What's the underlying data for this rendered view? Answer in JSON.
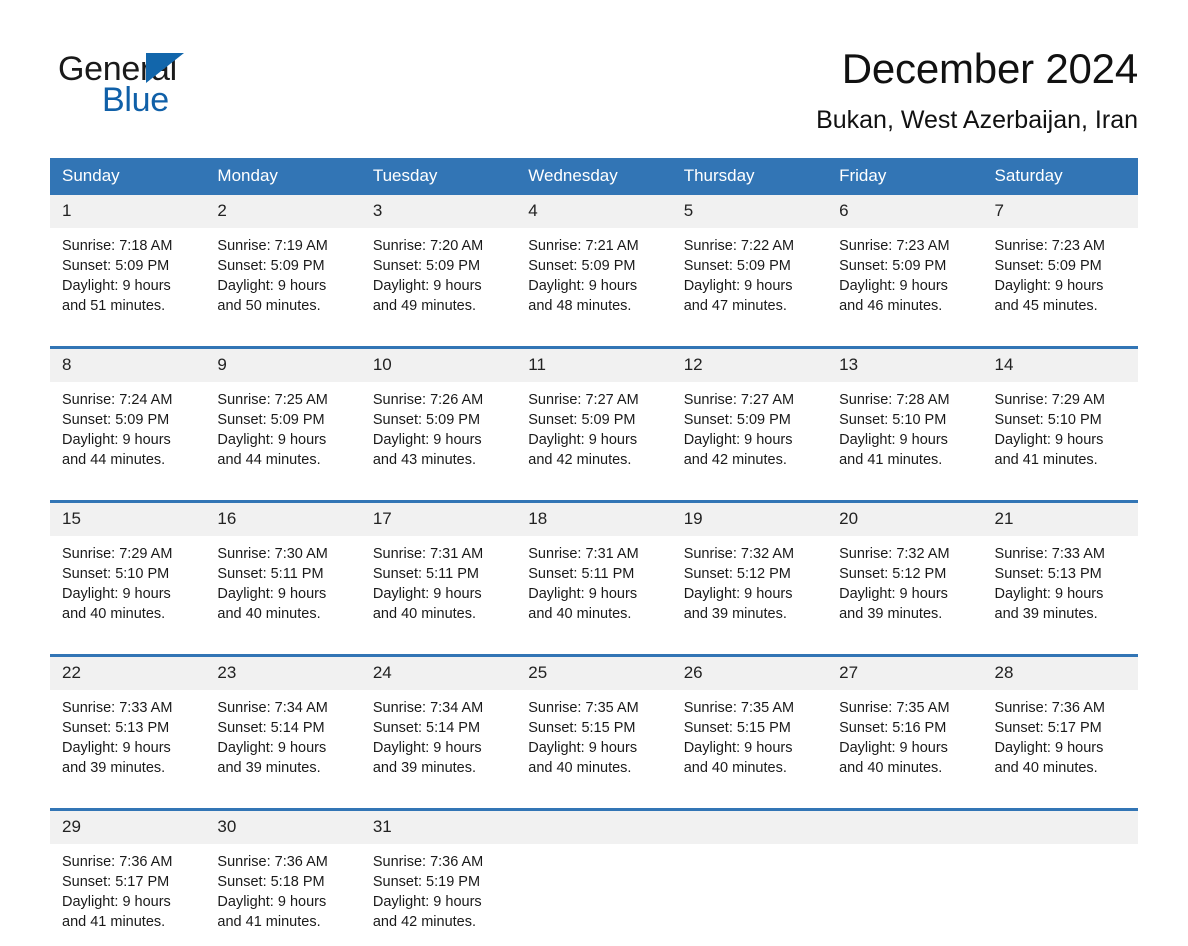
{
  "brand": {
    "word_one": "General",
    "word_two": "Blue",
    "triangle_color": "#1266ab",
    "text_color": "#1060a8"
  },
  "header": {
    "title": "December 2024",
    "location": "Bukan, West Azerbaijan, Iran"
  },
  "calendar": {
    "header_bg": "#3275b5",
    "daynum_bg": "#f1f1f1",
    "weekday_names": [
      "Sunday",
      "Monday",
      "Tuesday",
      "Wednesday",
      "Thursday",
      "Friday",
      "Saturday"
    ],
    "weeks": [
      [
        {
          "day": "1",
          "sunrise": "Sunrise: 7:18 AM",
          "sunset": "Sunset: 5:09 PM",
          "daylight_line1": "Daylight: 9 hours",
          "daylight_line2": "and 51 minutes."
        },
        {
          "day": "2",
          "sunrise": "Sunrise: 7:19 AM",
          "sunset": "Sunset: 5:09 PM",
          "daylight_line1": "Daylight: 9 hours",
          "daylight_line2": "and 50 minutes."
        },
        {
          "day": "3",
          "sunrise": "Sunrise: 7:20 AM",
          "sunset": "Sunset: 5:09 PM",
          "daylight_line1": "Daylight: 9 hours",
          "daylight_line2": "and 49 minutes."
        },
        {
          "day": "4",
          "sunrise": "Sunrise: 7:21 AM",
          "sunset": "Sunset: 5:09 PM",
          "daylight_line1": "Daylight: 9 hours",
          "daylight_line2": "and 48 minutes."
        },
        {
          "day": "5",
          "sunrise": "Sunrise: 7:22 AM",
          "sunset": "Sunset: 5:09 PM",
          "daylight_line1": "Daylight: 9 hours",
          "daylight_line2": "and 47 minutes."
        },
        {
          "day": "6",
          "sunrise": "Sunrise: 7:23 AM",
          "sunset": "Sunset: 5:09 PM",
          "daylight_line1": "Daylight: 9 hours",
          "daylight_line2": "and 46 minutes."
        },
        {
          "day": "7",
          "sunrise": "Sunrise: 7:23 AM",
          "sunset": "Sunset: 5:09 PM",
          "daylight_line1": "Daylight: 9 hours",
          "daylight_line2": "and 45 minutes."
        }
      ],
      [
        {
          "day": "8",
          "sunrise": "Sunrise: 7:24 AM",
          "sunset": "Sunset: 5:09 PM",
          "daylight_line1": "Daylight: 9 hours",
          "daylight_line2": "and 44 minutes."
        },
        {
          "day": "9",
          "sunrise": "Sunrise: 7:25 AM",
          "sunset": "Sunset: 5:09 PM",
          "daylight_line1": "Daylight: 9 hours",
          "daylight_line2": "and 44 minutes."
        },
        {
          "day": "10",
          "sunrise": "Sunrise: 7:26 AM",
          "sunset": "Sunset: 5:09 PM",
          "daylight_line1": "Daylight: 9 hours",
          "daylight_line2": "and 43 minutes."
        },
        {
          "day": "11",
          "sunrise": "Sunrise: 7:27 AM",
          "sunset": "Sunset: 5:09 PM",
          "daylight_line1": "Daylight: 9 hours",
          "daylight_line2": "and 42 minutes."
        },
        {
          "day": "12",
          "sunrise": "Sunrise: 7:27 AM",
          "sunset": "Sunset: 5:09 PM",
          "daylight_line1": "Daylight: 9 hours",
          "daylight_line2": "and 42 minutes."
        },
        {
          "day": "13",
          "sunrise": "Sunrise: 7:28 AM",
          "sunset": "Sunset: 5:10 PM",
          "daylight_line1": "Daylight: 9 hours",
          "daylight_line2": "and 41 minutes."
        },
        {
          "day": "14",
          "sunrise": "Sunrise: 7:29 AM",
          "sunset": "Sunset: 5:10 PM",
          "daylight_line1": "Daylight: 9 hours",
          "daylight_line2": "and 41 minutes."
        }
      ],
      [
        {
          "day": "15",
          "sunrise": "Sunrise: 7:29 AM",
          "sunset": "Sunset: 5:10 PM",
          "daylight_line1": "Daylight: 9 hours",
          "daylight_line2": "and 40 minutes."
        },
        {
          "day": "16",
          "sunrise": "Sunrise: 7:30 AM",
          "sunset": "Sunset: 5:11 PM",
          "daylight_line1": "Daylight: 9 hours",
          "daylight_line2": "and 40 minutes."
        },
        {
          "day": "17",
          "sunrise": "Sunrise: 7:31 AM",
          "sunset": "Sunset: 5:11 PM",
          "daylight_line1": "Daylight: 9 hours",
          "daylight_line2": "and 40 minutes."
        },
        {
          "day": "18",
          "sunrise": "Sunrise: 7:31 AM",
          "sunset": "Sunset: 5:11 PM",
          "daylight_line1": "Daylight: 9 hours",
          "daylight_line2": "and 40 minutes."
        },
        {
          "day": "19",
          "sunrise": "Sunrise: 7:32 AM",
          "sunset": "Sunset: 5:12 PM",
          "daylight_line1": "Daylight: 9 hours",
          "daylight_line2": "and 39 minutes."
        },
        {
          "day": "20",
          "sunrise": "Sunrise: 7:32 AM",
          "sunset": "Sunset: 5:12 PM",
          "daylight_line1": "Daylight: 9 hours",
          "daylight_line2": "and 39 minutes."
        },
        {
          "day": "21",
          "sunrise": "Sunrise: 7:33 AM",
          "sunset": "Sunset: 5:13 PM",
          "daylight_line1": "Daylight: 9 hours",
          "daylight_line2": "and 39 minutes."
        }
      ],
      [
        {
          "day": "22",
          "sunrise": "Sunrise: 7:33 AM",
          "sunset": "Sunset: 5:13 PM",
          "daylight_line1": "Daylight: 9 hours",
          "daylight_line2": "and 39 minutes."
        },
        {
          "day": "23",
          "sunrise": "Sunrise: 7:34 AM",
          "sunset": "Sunset: 5:14 PM",
          "daylight_line1": "Daylight: 9 hours",
          "daylight_line2": "and 39 minutes."
        },
        {
          "day": "24",
          "sunrise": "Sunrise: 7:34 AM",
          "sunset": "Sunset: 5:14 PM",
          "daylight_line1": "Daylight: 9 hours",
          "daylight_line2": "and 39 minutes."
        },
        {
          "day": "25",
          "sunrise": "Sunrise: 7:35 AM",
          "sunset": "Sunset: 5:15 PM",
          "daylight_line1": "Daylight: 9 hours",
          "daylight_line2": "and 40 minutes."
        },
        {
          "day": "26",
          "sunrise": "Sunrise: 7:35 AM",
          "sunset": "Sunset: 5:15 PM",
          "daylight_line1": "Daylight: 9 hours",
          "daylight_line2": "and 40 minutes."
        },
        {
          "day": "27",
          "sunrise": "Sunrise: 7:35 AM",
          "sunset": "Sunset: 5:16 PM",
          "daylight_line1": "Daylight: 9 hours",
          "daylight_line2": "and 40 minutes."
        },
        {
          "day": "28",
          "sunrise": "Sunrise: 7:36 AM",
          "sunset": "Sunset: 5:17 PM",
          "daylight_line1": "Daylight: 9 hours",
          "daylight_line2": "and 40 minutes."
        }
      ],
      [
        {
          "day": "29",
          "sunrise": "Sunrise: 7:36 AM",
          "sunset": "Sunset: 5:17 PM",
          "daylight_line1": "Daylight: 9 hours",
          "daylight_line2": "and 41 minutes."
        },
        {
          "day": "30",
          "sunrise": "Sunrise: 7:36 AM",
          "sunset": "Sunset: 5:18 PM",
          "daylight_line1": "Daylight: 9 hours",
          "daylight_line2": "and 41 minutes."
        },
        {
          "day": "31",
          "sunrise": "Sunrise: 7:36 AM",
          "sunset": "Sunset: 5:19 PM",
          "daylight_line1": "Daylight: 9 hours",
          "daylight_line2": "and 42 minutes."
        },
        {
          "day": "",
          "sunrise": "",
          "sunset": "",
          "daylight_line1": "",
          "daylight_line2": ""
        },
        {
          "day": "",
          "sunrise": "",
          "sunset": "",
          "daylight_line1": "",
          "daylight_line2": ""
        },
        {
          "day": "",
          "sunrise": "",
          "sunset": "",
          "daylight_line1": "",
          "daylight_line2": ""
        },
        {
          "day": "",
          "sunrise": "",
          "sunset": "",
          "daylight_line1": "",
          "daylight_line2": ""
        }
      ]
    ]
  }
}
